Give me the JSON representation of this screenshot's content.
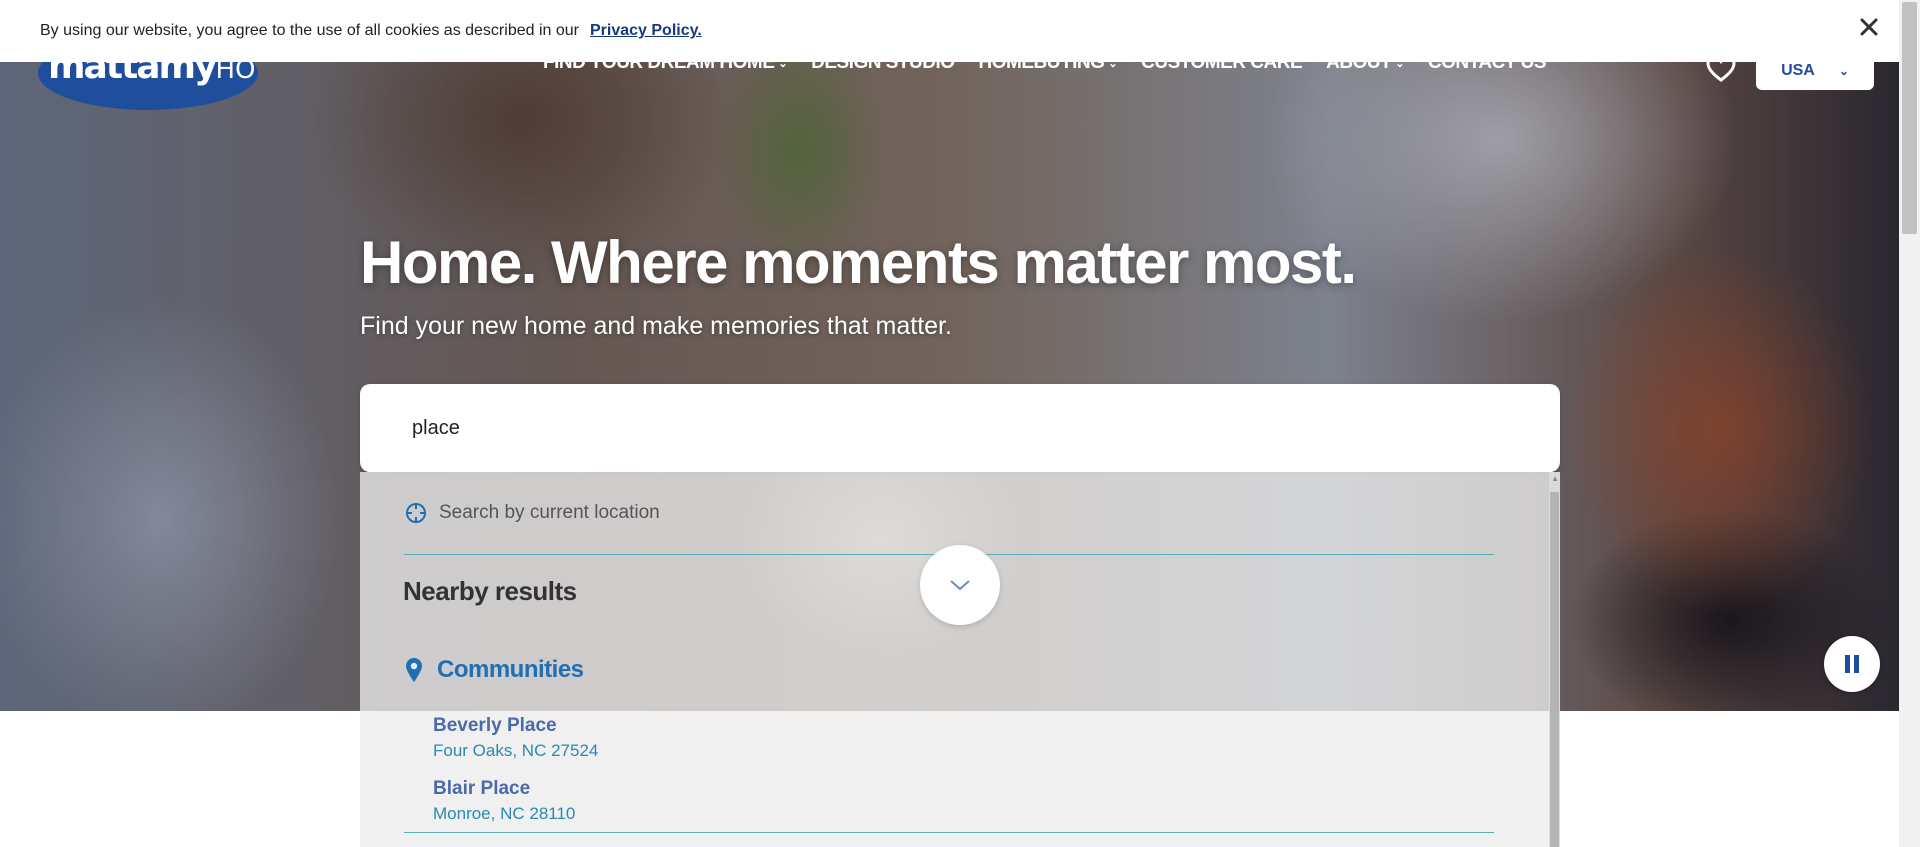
{
  "cookie_banner": {
    "text": "By using our website, you agree to the use of all cookies as described in our",
    "link": "Privacy Policy."
  },
  "logo": {
    "text_main": "mattamy",
    "text_sub": "HOMES"
  },
  "nav": {
    "items": [
      {
        "label": "FIND YOUR DREAM HOME",
        "has_dropdown": true
      },
      {
        "label": "DESIGN STUDIO",
        "has_dropdown": false
      },
      {
        "label": "HOMEBUYING",
        "has_dropdown": true
      },
      {
        "label": "CUSTOMER CARE",
        "has_dropdown": false
      },
      {
        "label": "ABOUT",
        "has_dropdown": true
      },
      {
        "label": "CONTACT US",
        "has_dropdown": false
      }
    ]
  },
  "country_select": {
    "value": "USA"
  },
  "hero": {
    "headline": "Home. Where moments matter most.",
    "subline": "Find your new home and make memories that matter."
  },
  "search": {
    "value": "place",
    "location_label": "Search by current location",
    "nearby_heading": "Nearby results",
    "communities_heading": "Communities",
    "results": [
      {
        "name": "Beverly Place",
        "location": "Four Oaks, NC 27524"
      },
      {
        "name": "Blair Place",
        "location": "Monroe, NC 28110"
      }
    ]
  },
  "colors": {
    "brand_blue": "#1f4f9c",
    "link_blue": "#1f6fb5",
    "divider_teal": "#5aaeb4"
  }
}
